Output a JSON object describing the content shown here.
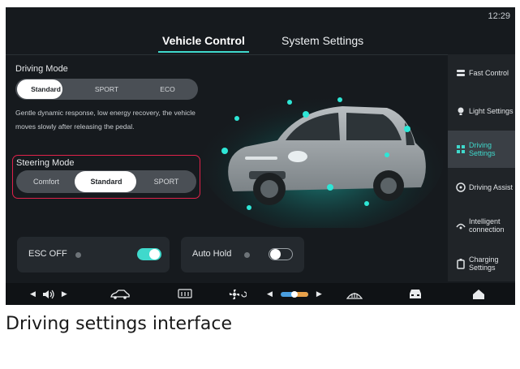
{
  "status": {
    "time": "12:29"
  },
  "tabs": [
    {
      "label": "Vehicle Control",
      "active": true
    },
    {
      "label": "System Settings",
      "active": false
    }
  ],
  "driving_mode": {
    "label": "Driving Mode",
    "options": [
      "Standard",
      "SPORT",
      "ECO"
    ],
    "selected": "Standard",
    "description": "Gentle dynamic response, low energy recovery, the vehicle moves slowly after releasing the pedal."
  },
  "steering_mode": {
    "label": "Steering Mode",
    "options": [
      "Comfort",
      "Standard",
      "SPORT"
    ],
    "selected": "Standard"
  },
  "toggles": [
    {
      "label": "ESC OFF",
      "state": "on"
    },
    {
      "label": "Auto Hold",
      "state": "off"
    }
  ],
  "sidebar": {
    "items": [
      {
        "label": "Fast Control",
        "icon": "fast-control-icon",
        "selected": false
      },
      {
        "label": "Light Settings",
        "icon": "light-icon",
        "selected": false
      },
      {
        "label": "Driving Settings",
        "icon": "driving-settings-icon",
        "selected": true
      },
      {
        "label": "Driving Assist",
        "icon": "steering-wheel-icon",
        "selected": false
      },
      {
        "label": "Intelligent connection",
        "icon": "connection-icon",
        "selected": false
      },
      {
        "label": "Charging Settings",
        "icon": "battery-icon",
        "selected": false
      }
    ]
  },
  "bottom_bar": {
    "icons": [
      "volume-icon",
      "car-outline-icon",
      "rear-defrost-icon",
      "fan-icon",
      "temperature-slider",
      "front-defrost-icon",
      "car-front-icon",
      "home-icon"
    ]
  },
  "colors": {
    "accent": "#3fd9cc",
    "highlight_box": "#e0224a",
    "background": "#161a1e"
  },
  "caption": "Driving settings interface"
}
